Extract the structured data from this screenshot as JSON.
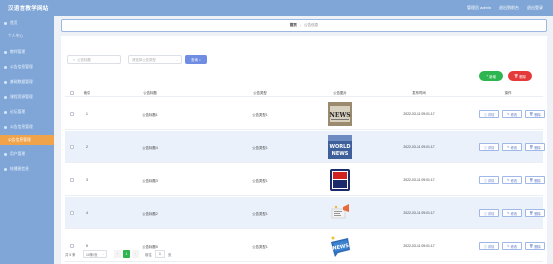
{
  "header": {
    "app_title": "汉语言教学网站",
    "admin_text": "管理员 admin",
    "back_home": "退出到前台",
    "logout": "退出登录"
  },
  "sidebar": {
    "items": [
      {
        "label": "首页",
        "level": "top",
        "active": false
      },
      {
        "label": "个人中心",
        "level": "sub",
        "active": false
      },
      {
        "label": "教师管理",
        "level": "top",
        "active": false
      },
      {
        "label": "公告信息管理",
        "level": "top",
        "active": false
      },
      {
        "label": "基础数据管理",
        "level": "top",
        "active": false
      },
      {
        "label": "课程资源管理",
        "level": "top",
        "active": false
      },
      {
        "label": "论坛管理",
        "level": "top",
        "active": false
      },
      {
        "label": "公告信息管理",
        "level": "top",
        "active": false
      },
      {
        "label": "公告信息管理",
        "level": "sub",
        "active": true
      },
      {
        "label": "用户管理",
        "level": "top",
        "active": false
      },
      {
        "label": "轮播图信息",
        "level": "top",
        "active": false
      }
    ]
  },
  "breadcrumb": {
    "home": "首页",
    "separator": "/",
    "current": "公告信息"
  },
  "search": {
    "title_placeholder": "公告标题",
    "type_placeholder": "请选择公告类型",
    "query_label": "查询"
  },
  "actions": {
    "add_label": "新增",
    "delete_label": "删除"
  },
  "table": {
    "columns": [
      "索引",
      "公告标题",
      "公告类型",
      "公告图片",
      "发布时间",
      "操作"
    ],
    "rows": [
      {
        "index": "1",
        "title": "公告标题1",
        "type": "公告类型1",
        "image": "news-paper-icon",
        "time": "2022-03-11 09:01:17"
      },
      {
        "index": "2",
        "title": "公告标题4",
        "type": "公告类型1",
        "image": "world-news-icon",
        "time": "2022-03-11 09:01:17"
      },
      {
        "index": "3",
        "title": "公告标题3",
        "type": "公告类型1",
        "image": "tv-news-icon",
        "time": "2022-03-11 09:01:17"
      },
      {
        "index": "4",
        "title": "公告标题2",
        "type": "公告类型1",
        "image": "megaphone-icon",
        "time": "2022-03-11 09:01:17"
      },
      {
        "index": "5",
        "title": "公告标题5",
        "type": "公告类型1",
        "image": "news-bubble-icon",
        "time": "2022-03-11 09:01:17"
      }
    ],
    "row_actions": [
      "详情",
      "修改",
      "删除"
    ]
  },
  "pager": {
    "total_text": "共 5 条",
    "page_size": "10条/页",
    "current_page": "1",
    "goto_prefix": "前往",
    "goto_value": "1",
    "goto_suffix": "页"
  },
  "colors": {
    "sidebar": "#7fa6d6",
    "active": "#f0a348",
    "add": "#2db54f",
    "delete": "#e53a3a",
    "query": "#6f8de3"
  }
}
